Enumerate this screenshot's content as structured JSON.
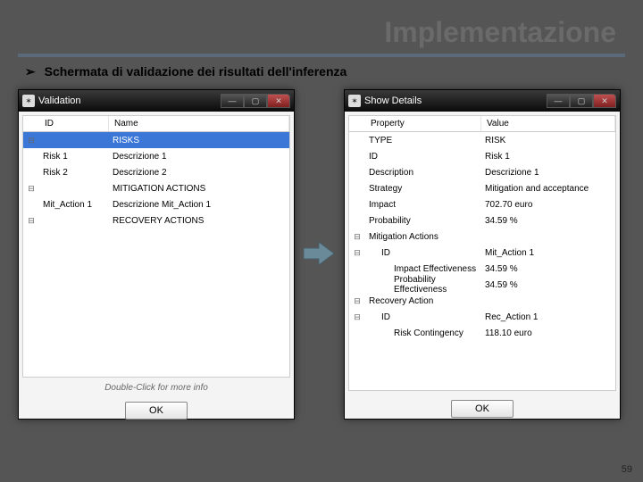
{
  "slide": {
    "title": "Implementazione",
    "caption": "Schermata di validazione dei risultati dell'inferenza",
    "page_number": "59"
  },
  "window1": {
    "title": "Validation",
    "columns": {
      "c1": "ID",
      "c2": "Name"
    },
    "rows": [
      {
        "expander": "⊟",
        "id": "",
        "name": "RISKS",
        "selected": true
      },
      {
        "expander": "",
        "id": "Risk 1",
        "name": "Descrizione 1"
      },
      {
        "expander": "",
        "id": "Risk 2",
        "name": "Descrizione 2"
      },
      {
        "expander": "⊟",
        "id": "",
        "name": "MITIGATION ACTIONS"
      },
      {
        "expander": "",
        "id": "Mit_Action 1",
        "name": "Descrizione Mit_Action 1"
      },
      {
        "expander": "⊟",
        "id": "",
        "name": "RECOVERY ACTIONS"
      }
    ],
    "hint": "Double-Click for more info",
    "ok": "OK"
  },
  "window2": {
    "title": "Show Details",
    "columns": {
      "c1": "Property",
      "c2": "Value"
    },
    "rows": [
      {
        "expander": "",
        "indent": 0,
        "prop": "TYPE",
        "val": "RISK"
      },
      {
        "expander": "",
        "indent": 0,
        "prop": "ID",
        "val": "Risk 1"
      },
      {
        "expander": "",
        "indent": 0,
        "prop": "Description",
        "val": "Descrizione 1"
      },
      {
        "expander": "",
        "indent": 0,
        "prop": "Strategy",
        "val": "Mitigation and acceptance"
      },
      {
        "expander": "",
        "indent": 0,
        "prop": "Impact",
        "val": "702.70 euro"
      },
      {
        "expander": "",
        "indent": 0,
        "prop": "Probability",
        "val": "34.59 %"
      },
      {
        "expander": "⊟",
        "indent": 0,
        "prop": "Mitigation Actions",
        "val": ""
      },
      {
        "expander": "⊟",
        "indent": 1,
        "prop": "ID",
        "val": "Mit_Action 1"
      },
      {
        "expander": "",
        "indent": 2,
        "prop": "Impact Effectiveness",
        "val": "34.59 %"
      },
      {
        "expander": "",
        "indent": 2,
        "prop": "Probability Effectiveness",
        "val": "34.59 %"
      },
      {
        "expander": "⊟",
        "indent": 0,
        "prop": "Recovery Action",
        "val": ""
      },
      {
        "expander": "⊟",
        "indent": 1,
        "prop": "ID",
        "val": "Rec_Action 1"
      },
      {
        "expander": "",
        "indent": 2,
        "prop": "Risk Contingency",
        "val": "118.10 euro"
      }
    ],
    "ok": "OK"
  }
}
